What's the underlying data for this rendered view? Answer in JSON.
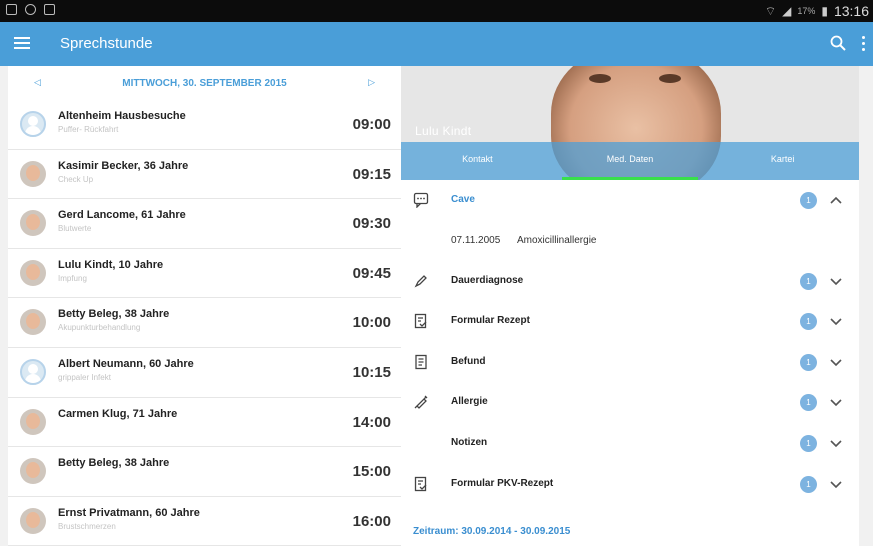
{
  "statusbar": {
    "battery": "17%",
    "time": "13:16"
  },
  "appbar": {
    "title": "Sprechstunde"
  },
  "datebar": {
    "prev": "◁",
    "date": "MITTWOCH, 30. SEPTEMBER 2015",
    "next": "▷"
  },
  "appointments": [
    {
      "name": "Altenheim Hausbesuche",
      "sub": "Puffer- Rückfahrt",
      "time": "09:00",
      "avatar": "placeholder"
    },
    {
      "name": "Kasimir Becker, 36 Jahre",
      "sub": "Check Up",
      "time": "09:15",
      "avatar": "photo"
    },
    {
      "name": "Gerd Lancome, 61 Jahre",
      "sub": "Blutwerte",
      "time": "09:30",
      "avatar": "photo"
    },
    {
      "name": "Lulu Kindt, 10 Jahre",
      "sub": "Impfung",
      "time": "09:45",
      "avatar": "photo"
    },
    {
      "name": "Betty Beleg, 38 Jahre",
      "sub": "Akupunkturbehandlung",
      "time": "10:00",
      "avatar": "photo"
    },
    {
      "name": "Albert Neumann, 60 Jahre",
      "sub": "grippaler Infekt",
      "time": "10:15",
      "avatar": "placeholder"
    },
    {
      "name": "Carmen Klug, 71 Jahre",
      "sub": "",
      "time": "14:00",
      "avatar": "photo"
    },
    {
      "name": "Betty Beleg, 38 Jahre",
      "sub": "",
      "time": "15:00",
      "avatar": "photo"
    },
    {
      "name": "Ernst Privatmann, 60 Jahre",
      "sub": "Brustschmerzen",
      "time": "16:00",
      "avatar": "photo"
    }
  ],
  "patient": {
    "name": "Lulu Kindt"
  },
  "tabs": [
    "Kontakt",
    "Med. Daten",
    "Kartei"
  ],
  "cave": {
    "label": "Cave",
    "badge": "1",
    "entry_date": "07.11.2005",
    "entry_text": "Amoxicillinallergie"
  },
  "sections": [
    {
      "label": "Dauerdiagnose",
      "badge": "1",
      "icon": "pen-icon"
    },
    {
      "label": "Formular Rezept",
      "badge": "1",
      "icon": "prescription-form-icon"
    },
    {
      "label": "Befund",
      "badge": "1",
      "icon": "document-icon"
    },
    {
      "label": "Allergie",
      "badge": "1",
      "icon": "syringe-icon"
    },
    {
      "label": "Notizen",
      "badge": "1",
      "icon": ""
    },
    {
      "label": "Formular PKV-Rezept",
      "badge": "1",
      "icon": "prescription-form-icon"
    }
  ],
  "period": "Zeitraum: 30.09.2014 - 30.09.2015",
  "colors": {
    "accent": "#4a9ed8",
    "tab_indicator": "#39e04b",
    "badge": "#7db3e0"
  }
}
